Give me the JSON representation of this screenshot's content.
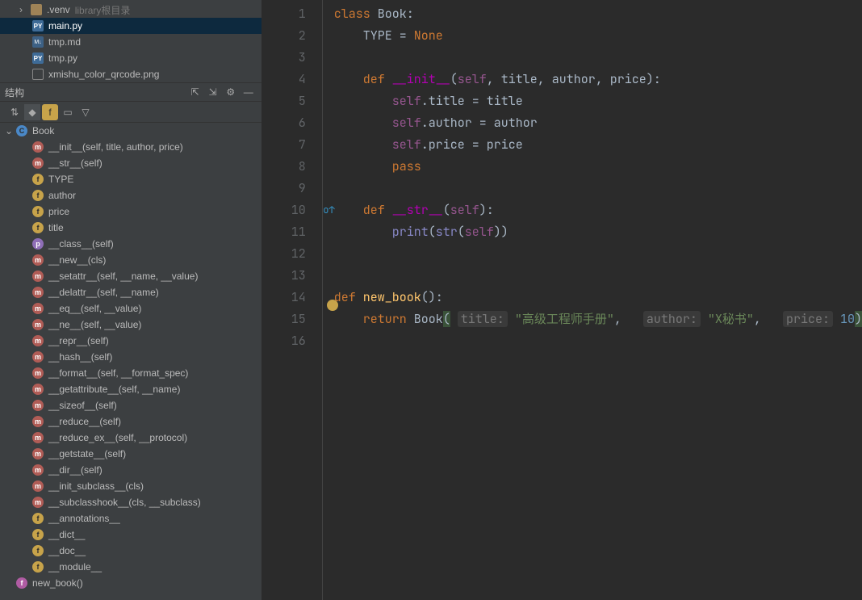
{
  "files": {
    "venv": ".venv",
    "venv_hint": "library根目录",
    "main": "main.py",
    "tmpmd": "tmp.md",
    "tmppy": "tmp.py",
    "img": "xmishu_color_qrcode.png"
  },
  "structure_label": "结构",
  "structure": {
    "class": "Book",
    "members": [
      {
        "badge": "m",
        "label": "__init__(self, title, author, price)"
      },
      {
        "badge": "m",
        "label": "__str__(self)"
      },
      {
        "badge": "f",
        "label": "TYPE"
      },
      {
        "badge": "f",
        "label": "author"
      },
      {
        "badge": "f",
        "label": "price"
      },
      {
        "badge": "f",
        "label": "title"
      },
      {
        "badge": "p",
        "label": "__class__(self)"
      },
      {
        "badge": "m",
        "label": "__new__(cls)"
      },
      {
        "badge": "m",
        "label": "__setattr__(self, __name, __value)"
      },
      {
        "badge": "m",
        "label": "__delattr__(self, __name)"
      },
      {
        "badge": "m",
        "label": "__eq__(self, __value)"
      },
      {
        "badge": "m",
        "label": "__ne__(self, __value)"
      },
      {
        "badge": "m",
        "label": "__repr__(self)"
      },
      {
        "badge": "m",
        "label": "__hash__(self)"
      },
      {
        "badge": "m",
        "label": "__format__(self, __format_spec)"
      },
      {
        "badge": "m",
        "label": "__getattribute__(self, __name)"
      },
      {
        "badge": "m",
        "label": "__sizeof__(self)"
      },
      {
        "badge": "m",
        "label": "__reduce__(self)"
      },
      {
        "badge": "m",
        "label": "__reduce_ex__(self, __protocol)"
      },
      {
        "badge": "m",
        "label": "__getstate__(self)"
      },
      {
        "badge": "m",
        "label": "__dir__(self)"
      },
      {
        "badge": "m",
        "label": "__init_subclass__(cls)"
      },
      {
        "badge": "m",
        "label": "__subclasshook__(cls, __subclass)"
      },
      {
        "badge": "f",
        "label": "__annotations__"
      },
      {
        "badge": "f",
        "label": "__dict__"
      },
      {
        "badge": "f",
        "label": "__doc__"
      },
      {
        "badge": "f",
        "label": "__module__"
      }
    ],
    "func": "new_book()"
  },
  "code": {
    "l1a": "class ",
    "l1b": "Book",
    "l1c": ":",
    "l2a": "    TYPE = ",
    "l2b": "None",
    "l4a": "    ",
    "l4b": "def ",
    "l4c": "__init__",
    "l4d": "(",
    "l4e": "self",
    "l4f": ", title, author, price):",
    "l5a": "        ",
    "l5b": "self",
    "l5c": ".title = title",
    "l6a": "        ",
    "l6b": "self",
    "l6c": ".author = author",
    "l7a": "        ",
    "l7b": "self",
    "l7c": ".price = price",
    "l8a": "        ",
    "l8b": "pass",
    "l10a": "    ",
    "l10b": "def ",
    "l10c": "__str__",
    "l10d": "(",
    "l10e": "self",
    "l10f": "):",
    "l11a": "        ",
    "l11b": "print",
    "l11c": "(",
    "l11d": "str",
    "l11e": "(",
    "l11f": "self",
    "l11g": "))",
    "l14a": "def ",
    "l14b": "new_book",
    "l14c": "():",
    "l15a": "    ",
    "l15b": "return ",
    "l15c": "Book",
    "l15d": "(",
    "l15h1": "title:",
    "l15s1": "\"高级工程师手册\"",
    "l15c1": ",",
    "l15h2": "author:",
    "l15s2": "\"X秘书\"",
    "l15c2": ",",
    "l15h3": "price:",
    "l15n": "10",
    "l15e": ")"
  },
  "line_numbers": [
    "1",
    "2",
    "3",
    "4",
    "5",
    "6",
    "7",
    "8",
    "9",
    "10",
    "11",
    "12",
    "13",
    "14",
    "15",
    "16"
  ]
}
